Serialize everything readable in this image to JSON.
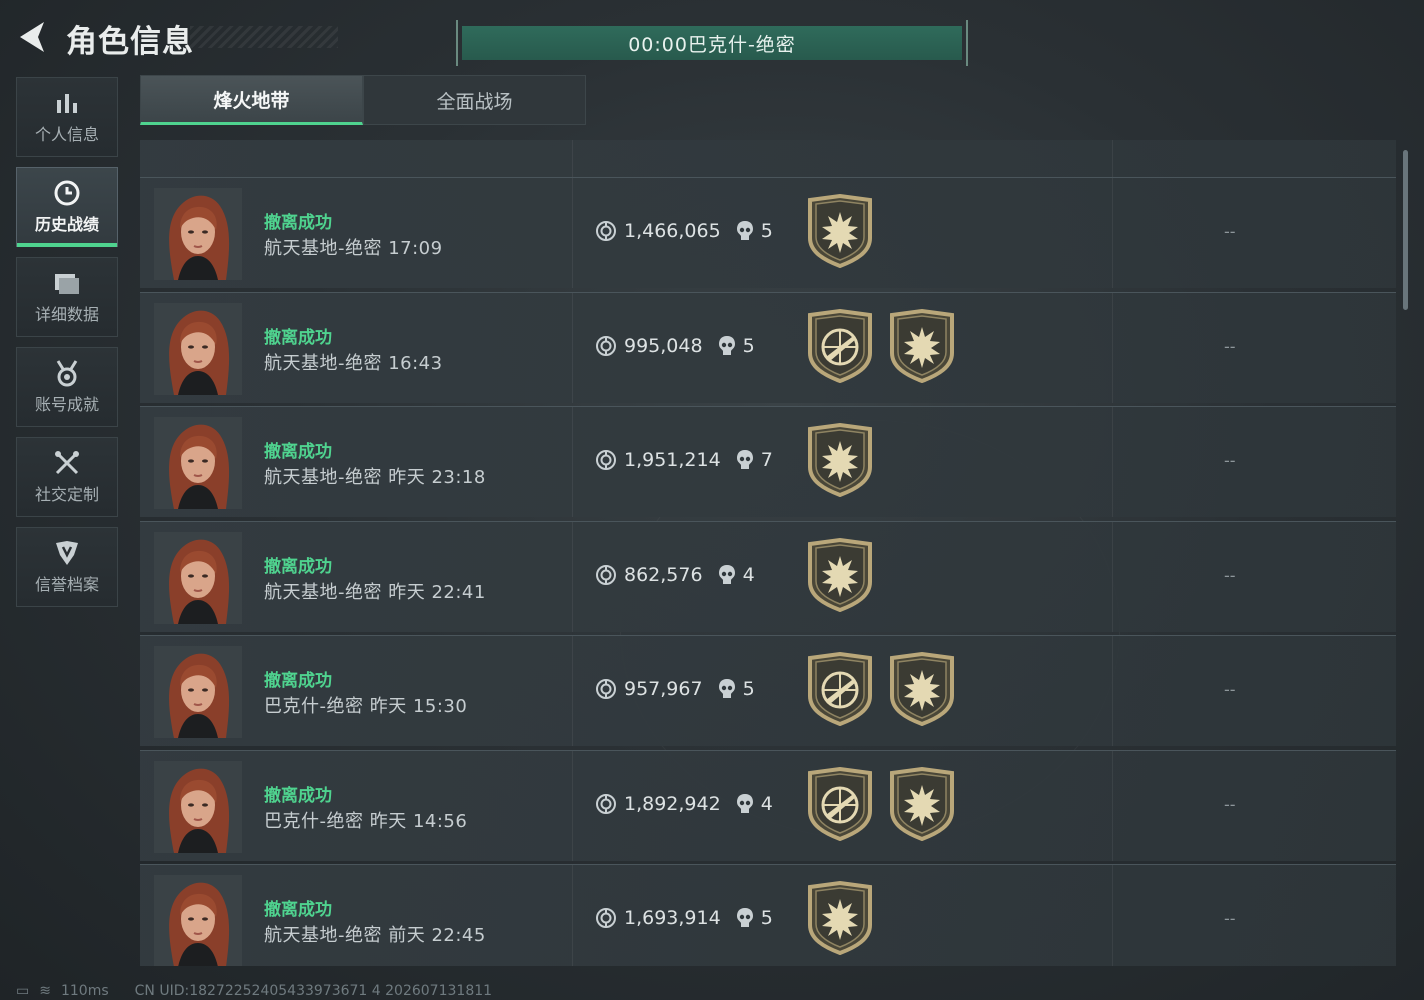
{
  "header": {
    "title": "角色信息",
    "timer_text": "00:00巴克什-绝密"
  },
  "sidebar": {
    "items": [
      {
        "label": "个人信息",
        "icon": "bar-chart-icon"
      },
      {
        "label": "历史战绩",
        "icon": "clock-icon",
        "active": true
      },
      {
        "label": "详细数据",
        "icon": "folder-icon"
      },
      {
        "label": "账号成就",
        "icon": "medal-icon"
      },
      {
        "label": "社交定制",
        "icon": "crossed-tools-icon"
      },
      {
        "label": "信誉档案",
        "icon": "shield-icon"
      }
    ]
  },
  "tabs": [
    {
      "label": "烽火地带",
      "active": true
    },
    {
      "label": "全面战场",
      "active": false
    }
  ],
  "matches": [
    {
      "result": "撤离成功",
      "map_time": "航天基地-绝密 17:09",
      "value": "1,466,065",
      "kills": "5",
      "badges": [
        "sun-emblem-badge"
      ],
      "extra": "--"
    },
    {
      "result": "撤离成功",
      "map_time": "航天基地-绝密 16:43",
      "value": "995,048",
      "kills": "5",
      "badges": [
        "rifle-emblem-badge",
        "sun-emblem-badge"
      ],
      "extra": "--"
    },
    {
      "result": "撤离成功",
      "map_time": "航天基地-绝密 昨天 23:18",
      "value": "1,951,214",
      "kills": "7",
      "badges": [
        "sun-emblem-badge"
      ],
      "extra": "--"
    },
    {
      "result": "撤离成功",
      "map_time": "航天基地-绝密 昨天 22:41",
      "value": "862,576",
      "kills": "4",
      "badges": [
        "sun-emblem-badge"
      ],
      "extra": "--"
    },
    {
      "result": "撤离成功",
      "map_time": "巴克什-绝密 昨天 15:30",
      "value": "957,967",
      "kills": "5",
      "badges": [
        "rifle-emblem-badge",
        "sun-emblem-badge"
      ],
      "extra": "--"
    },
    {
      "result": "撤离成功",
      "map_time": "巴克什-绝密 昨天 14:56",
      "value": "1,892,942",
      "kills": "4",
      "badges": [
        "rifle-emblem-badge",
        "sun-emblem-badge"
      ],
      "extra": "--"
    },
    {
      "result": "撤离成功",
      "map_time": "航天基地-绝密 前天 22:45",
      "value": "1,693,914",
      "kills": "5",
      "badges": [
        "sun-emblem-badge"
      ],
      "extra": "--"
    }
  ],
  "status_bar": {
    "ping": "110ms",
    "uid": "CN UID:18272252405433973671 4 202607131811"
  },
  "colors": {
    "accent_green": "#4fd38f",
    "timer_bar": "#2f6b5b",
    "badge_gold": "#b9a77a"
  }
}
